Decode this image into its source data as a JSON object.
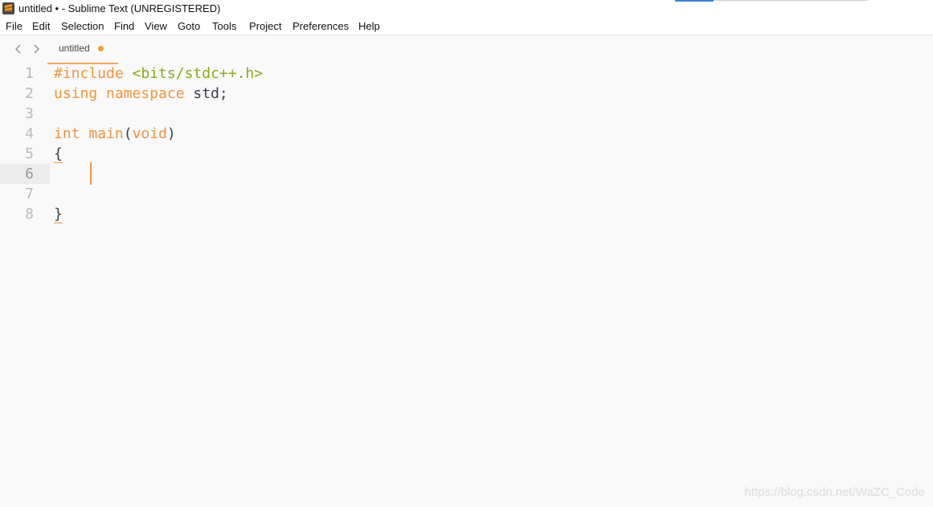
{
  "window": {
    "title": "untitled • - Sublime Text (UNREGISTERED)"
  },
  "menu": {
    "items": [
      "File",
      "Edit",
      "Selection",
      "Find",
      "View",
      "Goto",
      "Tools",
      "Project",
      "Preferences",
      "Help"
    ]
  },
  "tabs": [
    {
      "label": "untitled",
      "modified": true
    }
  ],
  "icons": {
    "app": "sublime-text-icon",
    "back": "chevron-left-icon",
    "forward": "chevron-right-icon",
    "dirty": "unsaved-dot-icon"
  },
  "editor": {
    "line_numbers": [
      "1",
      "2",
      "3",
      "4",
      "5",
      "6",
      "7",
      "8"
    ],
    "active_line": 6,
    "lines": {
      "l1": {
        "directive": "#include",
        "space": " ",
        "header": "<bits/stdc++.h>"
      },
      "l2": {
        "kw_using": "using",
        "sp1": " ",
        "kw_namespace": "namespace",
        "rest": " std;"
      },
      "l4": {
        "type": "int",
        "sp": " ",
        "name": "main",
        "open": "(",
        "param": "void",
        "close": ")"
      },
      "l5": {
        "text": "{"
      },
      "l8": {
        "text": "}"
      }
    }
  },
  "watermark": "https://blog.csdn.net/WaZC_Code",
  "colors": {
    "keyword": "#f0953d",
    "string": "#88aa1c",
    "text": "#3a4049",
    "background": "#f9f9f9",
    "tab_accent": "#f2a55a"
  }
}
